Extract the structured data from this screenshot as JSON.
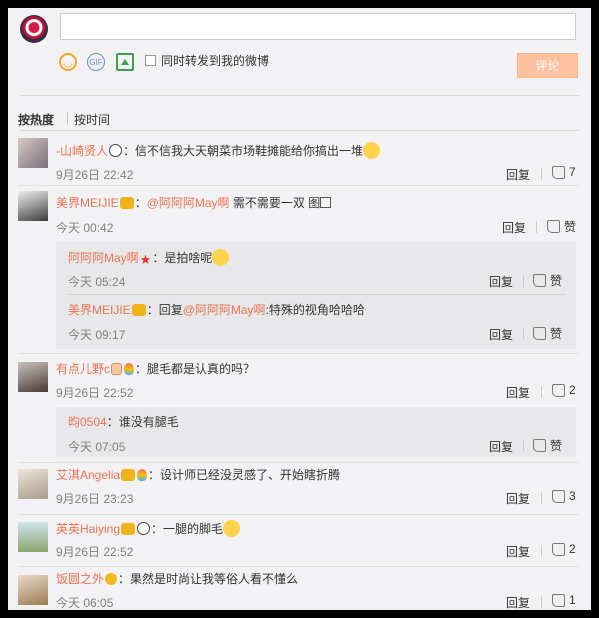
{
  "composer": {
    "placeholder": "",
    "repost_label": "同时转发到我的微博",
    "submit_label": "评论",
    "emoji_icon": "smile-icon",
    "gif_icon": "gif-icon",
    "image_icon": "image-icon"
  },
  "sort": {
    "hot": "按热度",
    "time": "按时间"
  },
  "actions": {
    "reply": "回复",
    "like_default": "赞"
  },
  "comments": [
    {
      "user": "-山崎贤人",
      "text": "：信不信我大天朝菜市场鞋摊能给你搞出一堆",
      "time": "9月26日 22:42",
      "likes": "7"
    },
    {
      "user": "美界MEIJIE",
      "mention": "@阿阿阿May啊",
      "text": " 需不需要一双 图",
      "time": "今天 00:42",
      "likes": "赞",
      "replies": [
        {
          "user": "阿阿阿May啊",
          "text": "：是拍啥呢",
          "time": "今天 05:24",
          "likes": "赞"
        },
        {
          "user": "美界MEIJIE",
          "prefix": "：回复",
          "mention": "@阿阿阿May啊",
          "text": ":特殊的视角哈哈哈",
          "time": "今天 09:17",
          "likes": "赞"
        }
      ]
    },
    {
      "user": "有点儿野c",
      "text": "：腿毛都是认真的吗？",
      "time": "9月26日 22:52",
      "likes": "2",
      "replies": [
        {
          "user": "昀0504",
          "text": "：谁没有腿毛",
          "time": "今天 07:05",
          "likes": "赞"
        }
      ]
    },
    {
      "user": "艾淇Angelia",
      "text": "：设计师已经没灵感了、开始瞎折腾",
      "time": "9月26日 23:23",
      "likes": "3"
    },
    {
      "user": "英英Haiying",
      "text": "：一腿的脚毛",
      "time": "9月26日 22:52",
      "likes": "2"
    },
    {
      "user": "饭圆之外",
      "text": "：果然是时尚让我等俗人看不懂么",
      "time": "今天 06:05",
      "likes": "1"
    }
  ]
}
